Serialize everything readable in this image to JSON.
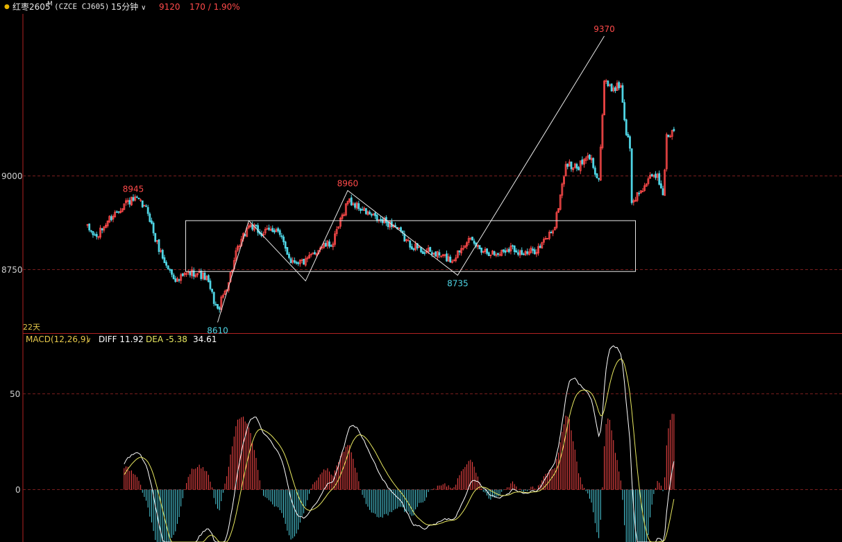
{
  "header": {
    "dot_color": "#e6b400",
    "symbol": "红枣2605",
    "symbol_mark": "M",
    "code": "(CZCE CJ605)",
    "period": "15分钟",
    "last_price": "9120",
    "change": "170 / 1.90%",
    "chevron_icon": "chevron-down-icon"
  },
  "price_panel": {
    "y_tick_labels": [
      "9000",
      "8750"
    ],
    "range_label": "22天",
    "annotations": [
      {
        "text": "8945",
        "kind": "high"
      },
      {
        "text": "8960",
        "kind": "high"
      },
      {
        "text": "9370",
        "kind": "high"
      },
      {
        "text": "8610",
        "kind": "low"
      },
      {
        "text": "8735",
        "kind": "low"
      }
    ]
  },
  "macd_panel": {
    "title": "MACD(12,26,9)",
    "diff_label": "DIFF 11.92",
    "dea_label": "DEA -5.38",
    "macd_value": "34.61",
    "y_tick_labels": [
      "50",
      "0"
    ]
  },
  "colors": {
    "up": "#ff4a4a",
    "down": "#4fd4e4",
    "axis": "#b22222",
    "grid": "#7a1e1e",
    "diff": "#ffffff",
    "dea": "#e8e860"
  },
  "chart_data": [
    {
      "type": "candlestick",
      "title": "红枣2605 (CZCE CJ605) 15分钟",
      "ylim": [
        8590,
        9420
      ],
      "y_ticks": [
        9000,
        8750
      ],
      "reference_levels": [
        9000,
        8750
      ],
      "range_box": {
        "high": 8880,
        "low": 8745
      },
      "swing_path": [
        {
          "i": 0,
          "v": 8610,
          "label": "8610"
        },
        {
          "i": 17,
          "v": 8880
        },
        {
          "i": 48,
          "v": 8720
        },
        {
          "i": 71,
          "v": 8960,
          "label": "8960"
        },
        {
          "i": 131,
          "v": 8735,
          "label": "8735"
        },
        {
          "i": 211,
          "v": 9370,
          "label": "9370"
        }
      ],
      "peak_labels": [
        {
          "i": -46,
          "v": 8945,
          "text": "8945"
        }
      ],
      "anchors": [
        {
          "i": -71,
          "v": 8860
        },
        {
          "i": -66,
          "v": 8835
        },
        {
          "i": -60,
          "v": 8880
        },
        {
          "i": -50,
          "v": 8930
        },
        {
          "i": -44,
          "v": 8935
        },
        {
          "i": -38,
          "v": 8905
        },
        {
          "i": -34,
          "v": 8830
        },
        {
          "i": -28,
          "v": 8760
        },
        {
          "i": -22,
          "v": 8720
        },
        {
          "i": -18,
          "v": 8735
        },
        {
          "i": -12,
          "v": 8745
        },
        {
          "i": -6,
          "v": 8725
        },
        {
          "i": 0,
          "v": 8640
        },
        {
          "i": 6,
          "v": 8720
        },
        {
          "i": 10,
          "v": 8790
        },
        {
          "i": 17,
          "v": 8870
        },
        {
          "i": 24,
          "v": 8845
        },
        {
          "i": 32,
          "v": 8860
        },
        {
          "i": 40,
          "v": 8775
        },
        {
          "i": 48,
          "v": 8770
        },
        {
          "i": 56,
          "v": 8810
        },
        {
          "i": 63,
          "v": 8820
        },
        {
          "i": 71,
          "v": 8935
        },
        {
          "i": 80,
          "v": 8905
        },
        {
          "i": 88,
          "v": 8880
        },
        {
          "i": 96,
          "v": 8870
        },
        {
          "i": 104,
          "v": 8820
        },
        {
          "i": 112,
          "v": 8800
        },
        {
          "i": 120,
          "v": 8790
        },
        {
          "i": 128,
          "v": 8775
        },
        {
          "i": 136,
          "v": 8830
        },
        {
          "i": 144,
          "v": 8805
        },
        {
          "i": 152,
          "v": 8790
        },
        {
          "i": 160,
          "v": 8810
        },
        {
          "i": 168,
          "v": 8790
        },
        {
          "i": 176,
          "v": 8810
        },
        {
          "i": 184,
          "v": 8865
        },
        {
          "i": 190,
          "v": 9030
        },
        {
          "i": 196,
          "v": 9020
        },
        {
          "i": 203,
          "v": 9050
        },
        {
          "i": 208,
          "v": 8990
        },
        {
          "i": 211,
          "v": 9250
        },
        {
          "i": 214,
          "v": 9230
        },
        {
          "i": 220,
          "v": 9240
        },
        {
          "i": 223,
          "v": 9110
        },
        {
          "i": 225,
          "v": 9080
        },
        {
          "i": 226,
          "v": 8920
        },
        {
          "i": 229,
          "v": 8950
        },
        {
          "i": 236,
          "v": 8990
        },
        {
          "i": 240,
          "v": 9000
        },
        {
          "i": 243,
          "v": 8950
        },
        {
          "i": 245,
          "v": 9100
        },
        {
          "i": 249,
          "v": 9120
        }
      ]
    },
    {
      "type": "macd",
      "title": "MACD(12,26,9)",
      "ylim": [
        -55,
        75
      ],
      "y_ticks": [
        50,
        0
      ],
      "series": [
        {
          "name": "DIFF",
          "last": 11.92
        },
        {
          "name": "DEA",
          "last": -5.38
        },
        {
          "name": "MACD",
          "last": 34.61
        }
      ]
    }
  ]
}
